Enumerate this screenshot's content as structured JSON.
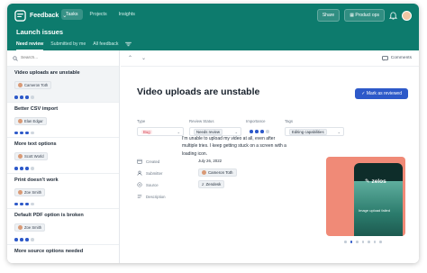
{
  "app": {
    "name": "Feedback"
  },
  "nav": {
    "tabs": [
      "Tasks",
      "Projects",
      "Insights"
    ],
    "active_tab": "Tasks"
  },
  "topbar": {
    "share_label": "Share",
    "product_ops_label": "Product ops"
  },
  "page": {
    "title": "Launch issues"
  },
  "subtabs": [
    "Need review",
    "Submitted by me",
    "All feedback"
  ],
  "search": {
    "placeholder": "Search..."
  },
  "issues": [
    {
      "title": "Video uploads are unstable",
      "person": "Cameron Toth",
      "dots_on": 3
    },
    {
      "title": "Better CSV import",
      "person": "Elan Edgar",
      "dots_on": 3
    },
    {
      "title": "More text options",
      "person": "Scott World",
      "dots_on": 3
    },
    {
      "title": "Print doesn't work",
      "person": "Zoe Smith",
      "dots_on": 3
    },
    {
      "title": "Default PDF option is broken",
      "person": "Zoe Smith",
      "dots_on": 3
    },
    {
      "title": "More source options needed",
      "person": "",
      "dots_on": 0
    }
  ],
  "detail": {
    "comments_label": "Comments",
    "title": "Video uploads are unstable",
    "mark_button": "Mark as reviewed",
    "fields": {
      "type_label": "Type",
      "type_value": "Bug",
      "status_label": "Review Status",
      "status_value": "Needs review",
      "importance_label": "Importance",
      "importance_dots_on": 3,
      "tags_label": "Tags",
      "tags_value": "Editing capabilities"
    },
    "created_label": "Created",
    "created_value": "July 26, 2022",
    "submitter_label": "Submitter",
    "submitter_value": "Cameron Toth",
    "source_label": "Source",
    "source_value": "Zendesk",
    "description_label": "Description",
    "description_value": "I'm unable to upload my video at all, even after multiple tries. I keep getting stuck on a screen with a loading icon.",
    "preview": {
      "brand": "zelos",
      "caption": "Image upload failed",
      "slides": 7,
      "active_slide": 1
    }
  },
  "colors": {
    "brand": "#0d7b6d",
    "accent": "#2d59c9",
    "bug": "#d63a4a",
    "preview_bg": "#f08a77"
  }
}
